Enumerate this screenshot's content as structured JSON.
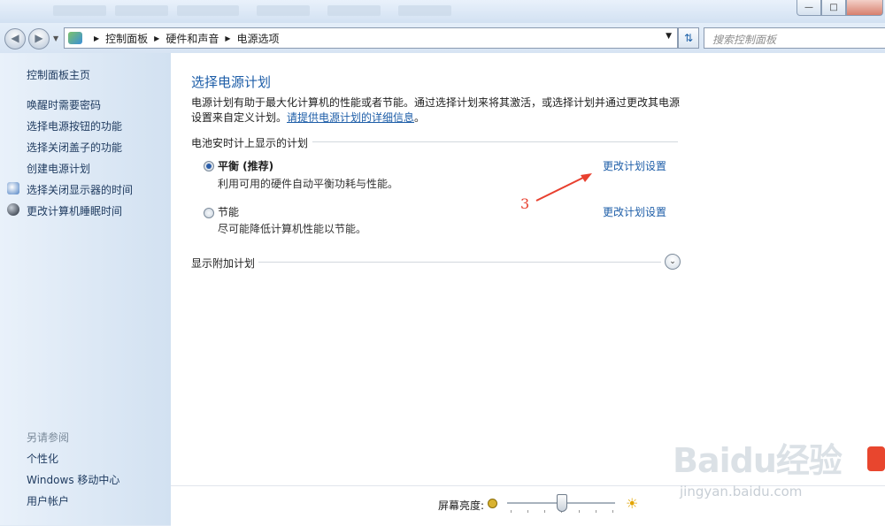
{
  "breadcrumb": [
    "控制面板",
    "硬件和声音",
    "电源选项"
  ],
  "search": {
    "placeholder": "搜索控制面板"
  },
  "sidebar": {
    "home": "控制面板主页",
    "items": [
      "唤醒时需要密码",
      "选择电源按钮的功能",
      "选择关闭盖子的功能",
      "创建电源计划",
      "选择关闭显示器的时间",
      "更改计算机睡眠时间"
    ],
    "see_also_title": "另请参阅",
    "see_also": [
      "个性化",
      "Windows 移动中心",
      "用户帐户"
    ]
  },
  "main": {
    "title": "选择电源计划",
    "description": "电源计划有助于最大化计算机的性能或者节能。通过选择计划来将其激活，或选择计划并通过更改其电源设置来自定义计划。",
    "description_link": "请提供电源计划的详细信息",
    "description_end": "。",
    "section_battery": "电池安时计上显示的计划",
    "plans": [
      {
        "name": "平衡 (推荐)",
        "desc": "利用可用的硬件自动平衡功耗与性能。",
        "selected": true,
        "link": "更改计划设置"
      },
      {
        "name": "节能",
        "desc": "尽可能降低计算机性能以节能。",
        "selected": false,
        "link": "更改计划设置"
      }
    ],
    "section_additional": "显示附加计划",
    "annotation": "3"
  },
  "bottom": {
    "brightness_label": "屏幕亮度:",
    "brightness_level": 0.5
  },
  "watermark": {
    "text": "Baidu经验",
    "url": "jingyan.baidu.com"
  },
  "colors": {
    "link": "#1e5ea8",
    "annotation": "#e8402f"
  }
}
